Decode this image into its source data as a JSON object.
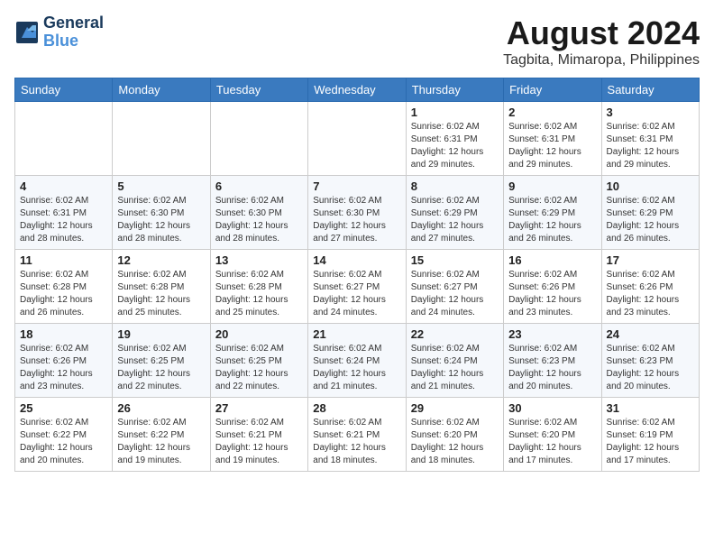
{
  "header": {
    "logo_line1": "General",
    "logo_line2": "Blue",
    "month_year": "August 2024",
    "location": "Tagbita, Mimaropa, Philippines"
  },
  "weekdays": [
    "Sunday",
    "Monday",
    "Tuesday",
    "Wednesday",
    "Thursday",
    "Friday",
    "Saturday"
  ],
  "weeks": [
    [
      {
        "day": "",
        "info": ""
      },
      {
        "day": "",
        "info": ""
      },
      {
        "day": "",
        "info": ""
      },
      {
        "day": "",
        "info": ""
      },
      {
        "day": "1",
        "info": "Sunrise: 6:02 AM\nSunset: 6:31 PM\nDaylight: 12 hours\nand 29 minutes."
      },
      {
        "day": "2",
        "info": "Sunrise: 6:02 AM\nSunset: 6:31 PM\nDaylight: 12 hours\nand 29 minutes."
      },
      {
        "day": "3",
        "info": "Sunrise: 6:02 AM\nSunset: 6:31 PM\nDaylight: 12 hours\nand 29 minutes."
      }
    ],
    [
      {
        "day": "4",
        "info": "Sunrise: 6:02 AM\nSunset: 6:31 PM\nDaylight: 12 hours\nand 28 minutes."
      },
      {
        "day": "5",
        "info": "Sunrise: 6:02 AM\nSunset: 6:30 PM\nDaylight: 12 hours\nand 28 minutes."
      },
      {
        "day": "6",
        "info": "Sunrise: 6:02 AM\nSunset: 6:30 PM\nDaylight: 12 hours\nand 28 minutes."
      },
      {
        "day": "7",
        "info": "Sunrise: 6:02 AM\nSunset: 6:30 PM\nDaylight: 12 hours\nand 27 minutes."
      },
      {
        "day": "8",
        "info": "Sunrise: 6:02 AM\nSunset: 6:29 PM\nDaylight: 12 hours\nand 27 minutes."
      },
      {
        "day": "9",
        "info": "Sunrise: 6:02 AM\nSunset: 6:29 PM\nDaylight: 12 hours\nand 26 minutes."
      },
      {
        "day": "10",
        "info": "Sunrise: 6:02 AM\nSunset: 6:29 PM\nDaylight: 12 hours\nand 26 minutes."
      }
    ],
    [
      {
        "day": "11",
        "info": "Sunrise: 6:02 AM\nSunset: 6:28 PM\nDaylight: 12 hours\nand 26 minutes."
      },
      {
        "day": "12",
        "info": "Sunrise: 6:02 AM\nSunset: 6:28 PM\nDaylight: 12 hours\nand 25 minutes."
      },
      {
        "day": "13",
        "info": "Sunrise: 6:02 AM\nSunset: 6:28 PM\nDaylight: 12 hours\nand 25 minutes."
      },
      {
        "day": "14",
        "info": "Sunrise: 6:02 AM\nSunset: 6:27 PM\nDaylight: 12 hours\nand 24 minutes."
      },
      {
        "day": "15",
        "info": "Sunrise: 6:02 AM\nSunset: 6:27 PM\nDaylight: 12 hours\nand 24 minutes."
      },
      {
        "day": "16",
        "info": "Sunrise: 6:02 AM\nSunset: 6:26 PM\nDaylight: 12 hours\nand 23 minutes."
      },
      {
        "day": "17",
        "info": "Sunrise: 6:02 AM\nSunset: 6:26 PM\nDaylight: 12 hours\nand 23 minutes."
      }
    ],
    [
      {
        "day": "18",
        "info": "Sunrise: 6:02 AM\nSunset: 6:26 PM\nDaylight: 12 hours\nand 23 minutes."
      },
      {
        "day": "19",
        "info": "Sunrise: 6:02 AM\nSunset: 6:25 PM\nDaylight: 12 hours\nand 22 minutes."
      },
      {
        "day": "20",
        "info": "Sunrise: 6:02 AM\nSunset: 6:25 PM\nDaylight: 12 hours\nand 22 minutes."
      },
      {
        "day": "21",
        "info": "Sunrise: 6:02 AM\nSunset: 6:24 PM\nDaylight: 12 hours\nand 21 minutes."
      },
      {
        "day": "22",
        "info": "Sunrise: 6:02 AM\nSunset: 6:24 PM\nDaylight: 12 hours\nand 21 minutes."
      },
      {
        "day": "23",
        "info": "Sunrise: 6:02 AM\nSunset: 6:23 PM\nDaylight: 12 hours\nand 20 minutes."
      },
      {
        "day": "24",
        "info": "Sunrise: 6:02 AM\nSunset: 6:23 PM\nDaylight: 12 hours\nand 20 minutes."
      }
    ],
    [
      {
        "day": "25",
        "info": "Sunrise: 6:02 AM\nSunset: 6:22 PM\nDaylight: 12 hours\nand 20 minutes."
      },
      {
        "day": "26",
        "info": "Sunrise: 6:02 AM\nSunset: 6:22 PM\nDaylight: 12 hours\nand 19 minutes."
      },
      {
        "day": "27",
        "info": "Sunrise: 6:02 AM\nSunset: 6:21 PM\nDaylight: 12 hours\nand 19 minutes."
      },
      {
        "day": "28",
        "info": "Sunrise: 6:02 AM\nSunset: 6:21 PM\nDaylight: 12 hours\nand 18 minutes."
      },
      {
        "day": "29",
        "info": "Sunrise: 6:02 AM\nSunset: 6:20 PM\nDaylight: 12 hours\nand 18 minutes."
      },
      {
        "day": "30",
        "info": "Sunrise: 6:02 AM\nSunset: 6:20 PM\nDaylight: 12 hours\nand 17 minutes."
      },
      {
        "day": "31",
        "info": "Sunrise: 6:02 AM\nSunset: 6:19 PM\nDaylight: 12 hours\nand 17 minutes."
      }
    ]
  ]
}
